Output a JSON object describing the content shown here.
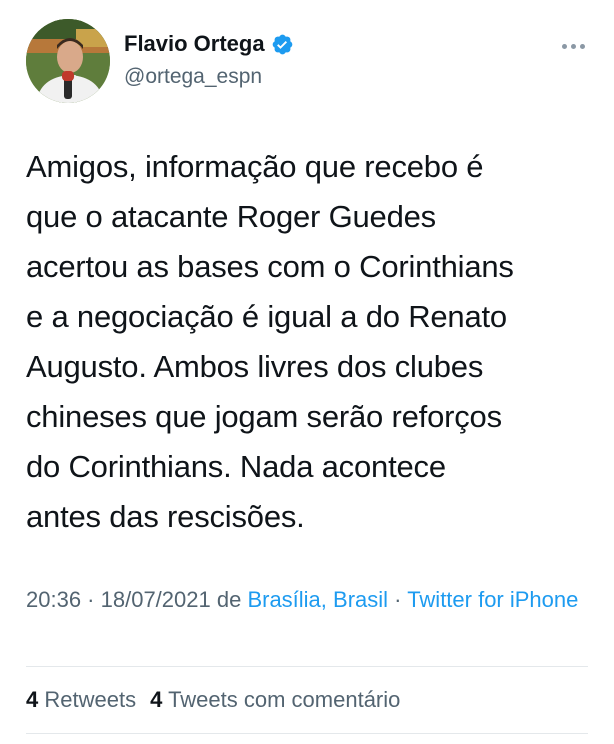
{
  "author": {
    "display_name": "Flavio Ortega",
    "handle": "@ortega_espn",
    "verified_icon": "verified-badge-icon"
  },
  "tweet": {
    "text_lines": [
      "Amigos, informação que recebo é",
      "que o atacante Roger Guedes",
      "acertou as bases com o Corinthians",
      "e a negociação é igual a do Renato",
      "Augusto. Ambos livres dos clubes",
      "chineses que jogam serão reforços",
      "do Corinthians. Nada acontece",
      "antes das rescisões."
    ]
  },
  "meta": {
    "time": "20:36",
    "sep1": " · ",
    "date": "18/07/2021",
    "from_label": " de ",
    "location": "Brasília, Brasil",
    "sep2": " · ",
    "source": "Twitter for iPhone"
  },
  "stats": {
    "retweets_count": "4",
    "retweets_label": "Retweets",
    "quotes_count": "4",
    "quotes_label": "Tweets com comentário"
  },
  "colors": {
    "link": "#1d9bf0",
    "secondary_text": "#536471",
    "primary_text": "#0f1419",
    "verified": "#1d9bf0"
  }
}
